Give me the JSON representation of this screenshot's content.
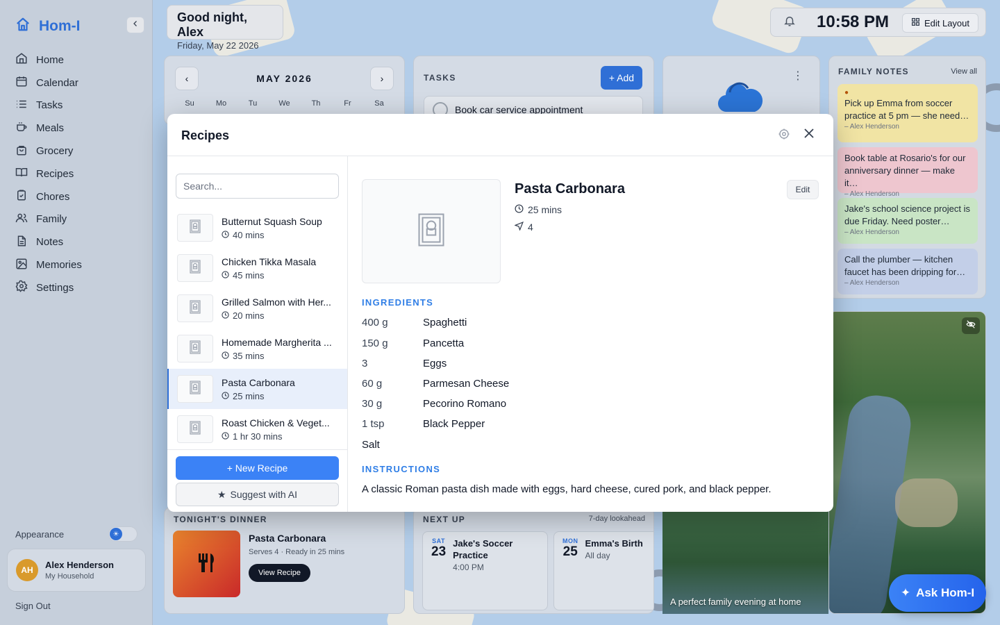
{
  "app": {
    "name": "Hom-I"
  },
  "sidebar": {
    "items": [
      {
        "label": "Home"
      },
      {
        "label": "Calendar"
      },
      {
        "label": "Tasks"
      },
      {
        "label": "Meals"
      },
      {
        "label": "Grocery"
      },
      {
        "label": "Recipes"
      },
      {
        "label": "Chores"
      },
      {
        "label": "Family"
      },
      {
        "label": "Notes"
      },
      {
        "label": "Memories"
      },
      {
        "label": "Settings"
      }
    ],
    "appearance_label": "Appearance",
    "user": {
      "initials": "AH",
      "name": "Alex Henderson",
      "household": "My Household"
    },
    "sign_out": "Sign Out"
  },
  "header": {
    "greeting": "Good night, Alex",
    "date": "Friday, May 22 2026",
    "time": "10:58 PM",
    "edit_layout": "Edit Layout"
  },
  "calendar": {
    "month": "MAY 2026",
    "days": [
      "Su",
      "Mo",
      "Tu",
      "We",
      "Th",
      "Fr",
      "Sa"
    ]
  },
  "tasks": {
    "title": "TASKS",
    "add_label": "+ Add",
    "items": [
      {
        "label": "Book car service appointment"
      }
    ]
  },
  "family_notes": {
    "title": "FAMILY NOTES",
    "view_all": "View all",
    "notes": [
      {
        "text": "Pick up Emma from soccer practice at 5 pm — she need…",
        "author": "– Alex Henderson",
        "color": "#f1e4a4"
      },
      {
        "text": "Book table at Rosario's for our anniversary dinner — make it…",
        "author": "– Alex Henderson",
        "color": "#eec6cf"
      },
      {
        "text": "Jake's school science project is due Friday. Need poster…",
        "author": "– Alex Henderson",
        "color": "#c9e5c5"
      },
      {
        "text": "Call the plumber — kitchen faucet has been dripping for…",
        "author": "– Alex Henderson",
        "color": "#c3cfe8"
      }
    ]
  },
  "memories": {
    "caption": "A perfect family evening at home"
  },
  "tonights_dinner": {
    "title": "TONIGHT'S DINNER",
    "name": "Pasta Carbonara",
    "sub": "Serves 4 · Ready in 25 mins",
    "button": "View Recipe"
  },
  "next_up": {
    "title": "NEXT UP",
    "lookahead": "7-day lookahead",
    "events": [
      {
        "dow": "SAT",
        "day": "23",
        "title": "Jake's Soccer Practice",
        "time": "4:00 PM"
      },
      {
        "dow": "MON",
        "day": "25",
        "title": "Emma's Birth",
        "time": "All day"
      }
    ]
  },
  "ask_button": "Ask Hom-I",
  "modal": {
    "title": "Recipes",
    "search_placeholder": "Search...",
    "recipes": [
      {
        "name": "Butternut Squash Soup",
        "time": "40 mins"
      },
      {
        "name": "Chicken Tikka Masala",
        "time": "45 mins"
      },
      {
        "name": "Grilled Salmon with Her...",
        "time": "20 mins"
      },
      {
        "name": "Homemade Margherita ...",
        "time": "35 mins"
      },
      {
        "name": "Pasta Carbonara",
        "time": "25 mins"
      },
      {
        "name": "Roast Chicken & Veget...",
        "time": "1 hr 30 mins"
      }
    ],
    "new_recipe": "+ New Recipe",
    "suggest_ai": "Suggest with AI",
    "detail": {
      "title": "Pasta Carbonara",
      "time": "25 mins",
      "servings": "4",
      "edit": "Edit",
      "ingredients_heading": "INGREDIENTS",
      "ingredients": [
        {
          "qty": "400 g",
          "item": "Spaghetti"
        },
        {
          "qty": "150 g",
          "item": "Pancetta"
        },
        {
          "qty": "3",
          "item": "Eggs"
        },
        {
          "qty": "60 g",
          "item": "Parmesan Cheese"
        },
        {
          "qty": "30 g",
          "item": "Pecorino Romano"
        },
        {
          "qty": "1 tsp",
          "item": "Black Pepper"
        },
        {
          "qty": "Salt",
          "item": ""
        }
      ],
      "instructions_heading": "INSTRUCTIONS",
      "instructions": "A classic Roman pasta dish made with eggs, hard cheese, cured pork, and black pepper."
    }
  },
  "colors": {
    "accent": "#2f6fd6",
    "section_heading": "#2f7ee6"
  }
}
